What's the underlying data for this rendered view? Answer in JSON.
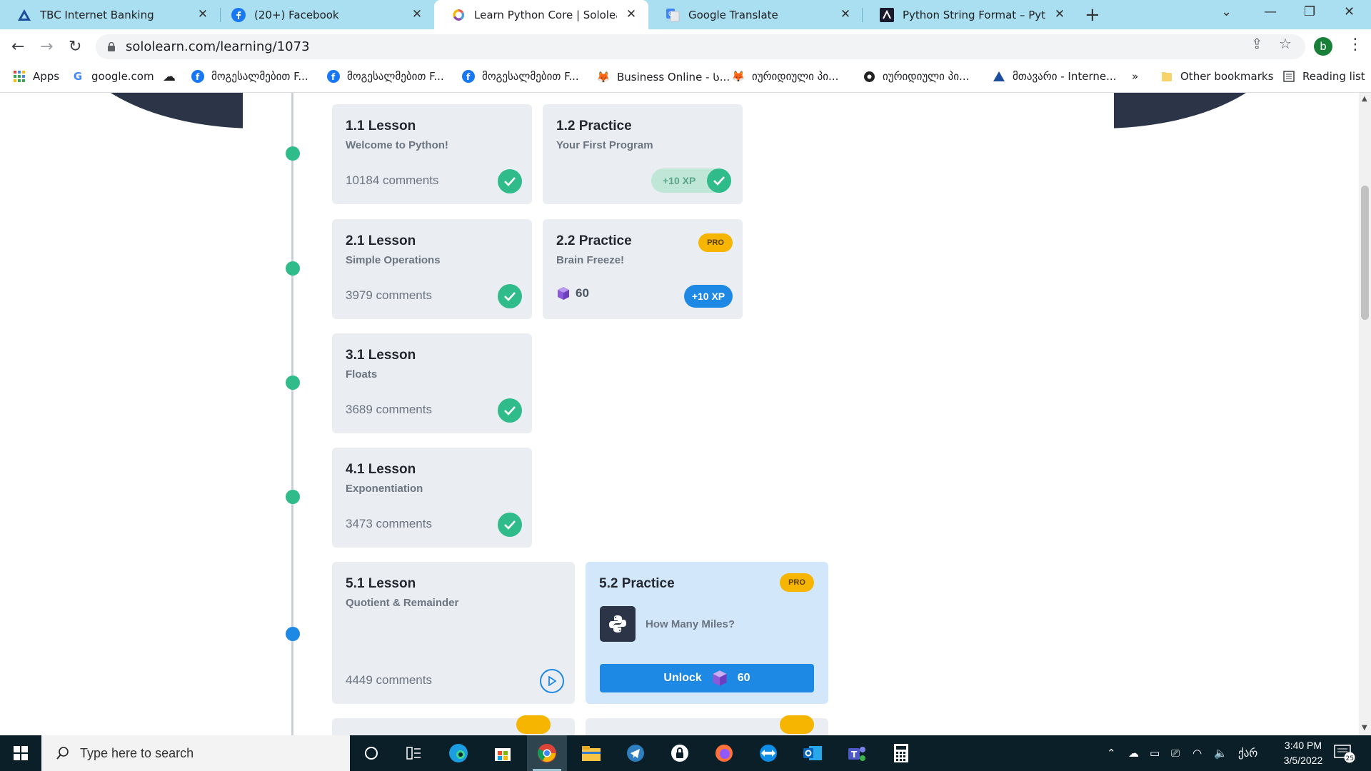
{
  "browser": {
    "tabs": [
      {
        "title": "TBC Internet Banking",
        "icon": "tbc-icon",
        "active": false
      },
      {
        "title": "(20+) Facebook",
        "icon": "facebook-icon",
        "active": false
      },
      {
        "title": "Learn Python Core | Sololearn",
        "icon": "sololearn-icon",
        "active": true
      },
      {
        "title": "Google Translate",
        "icon": "google-translate-icon",
        "active": false
      },
      {
        "title": "Python String Format – Python S",
        "icon": "w3-icon",
        "active": false
      }
    ],
    "new_tab_label": "+",
    "url": "sololearn.com/learning/1073",
    "profile_initial": "b",
    "bookmarks": [
      {
        "label": "Apps",
        "icon": "apps-grid-icon"
      },
      {
        "label": "google.com",
        "icon": "google-icon"
      },
      {
        "label": "",
        "icon": "cloud-icon"
      },
      {
        "label": "მოგესალმებით F...",
        "icon": "facebook-icon"
      },
      {
        "label": "მოგესალმებით F...",
        "icon": "facebook-icon"
      },
      {
        "label": "მოგესალმებით F...",
        "icon": "facebook-icon"
      },
      {
        "label": "Business Online - Ს...",
        "icon": "fox-icon"
      },
      {
        "label": "იურიდიული პი...",
        "icon": "fox-icon"
      },
      {
        "label": "იურიდიული პი...",
        "icon": "globe-icon"
      },
      {
        "label": "მთავარი - Interne...",
        "icon": "tbc-icon"
      }
    ],
    "bookmarks_overflow": "»",
    "other_bookmarks": "Other bookmarks",
    "reading_list": "Reading list"
  },
  "lessons": [
    {
      "title": "1.1 Lesson",
      "subtitle": "Welcome to Python!",
      "comments": "10184 comments",
      "status": "done"
    },
    {
      "title": "2.1 Lesson",
      "subtitle": "Simple Operations",
      "comments": "3979 comments",
      "status": "done"
    },
    {
      "title": "3.1 Lesson",
      "subtitle": "Floats",
      "comments": "3689 comments",
      "status": "done"
    },
    {
      "title": "4.1 Lesson",
      "subtitle": "Exponentiation",
      "comments": "3473 comments",
      "status": "done"
    },
    {
      "title": "5.1 Lesson",
      "subtitle": "Quotient & Remainder",
      "comments": "4449 comments",
      "status": "current"
    }
  ],
  "practices": [
    {
      "title": "1.2 Practice",
      "subtitle": "Your First Program",
      "xp": "+10 XP",
      "status": "done"
    },
    {
      "title": "2.2 Practice",
      "subtitle": "Brain Freeze!",
      "badge": "PRO",
      "gems": "60",
      "xp": "+10 XP"
    },
    {
      "title": "5.2 Practice",
      "badge": "PRO",
      "task": "How Many Miles?",
      "unlock_label": "Unlock",
      "unlock_cost": "60"
    }
  ],
  "taskbar": {
    "search_placeholder": "Type here to search",
    "time": "3:40 PM",
    "date": "3/5/2022",
    "language": "ქარ",
    "notification_count": "25"
  },
  "colors": {
    "accent": "#1e88e5",
    "success": "#2fbc8a",
    "pro": "#f5b500",
    "card_bg": "#eaeef2"
  }
}
